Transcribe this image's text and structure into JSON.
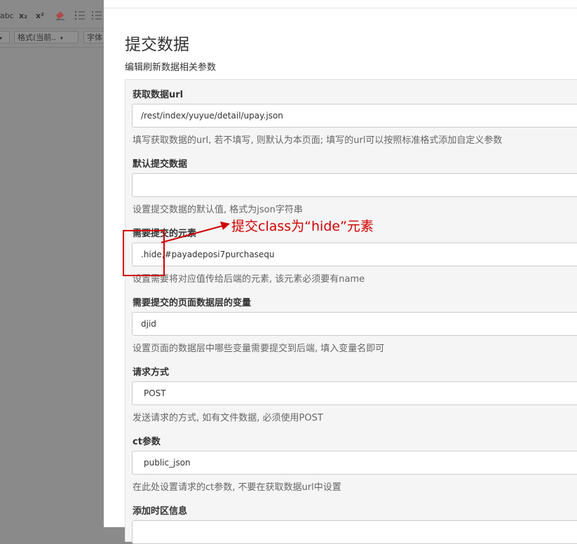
{
  "toolbar": {
    "row1_glyphs": [
      "abc",
      "x₂",
      "x²"
    ],
    "format_select": "格式(当前..",
    "font_select": "字体"
  },
  "modal": {
    "title": "提交数据",
    "subtitle": "编辑刷新数据相关参数",
    "fields": [
      {
        "label": "获取数据url",
        "value": "/rest/index/yuyue/detail/upay.json",
        "help": "填写获取数据的url, 若不填写, 则默认为本页面; 填写的url可以按照标准格式添加自定义参数"
      },
      {
        "label": "默认提交数据",
        "value": "",
        "help": "设置提交数据的默认值, 格式为json字符串"
      },
      {
        "label": "需要提交的元素",
        "value": ".hide,#payadeposi7purchasequ",
        "help": "设置需要将对应值传给后端的元素, 该元素必须要有name"
      },
      {
        "label": "需要提交的页面数据层的变量",
        "value": "djid",
        "help": "设置页面的数据层中哪些变量需要提交到后端, 填入变量名即可"
      },
      {
        "label": "请求方式",
        "value": "POST",
        "help": "发送请求的方式, 如有文件数据, 必须使用POST"
      },
      {
        "label": "ct参数",
        "value": "public_json",
        "help": "在此处设置请求的ct参数, 不要在获取数据url中设置"
      },
      {
        "label": "添加时区信息",
        "value": "",
        "help": ""
      }
    ]
  },
  "annotation": {
    "text": "提交class为“hide”元素",
    "color": "#d00000"
  }
}
